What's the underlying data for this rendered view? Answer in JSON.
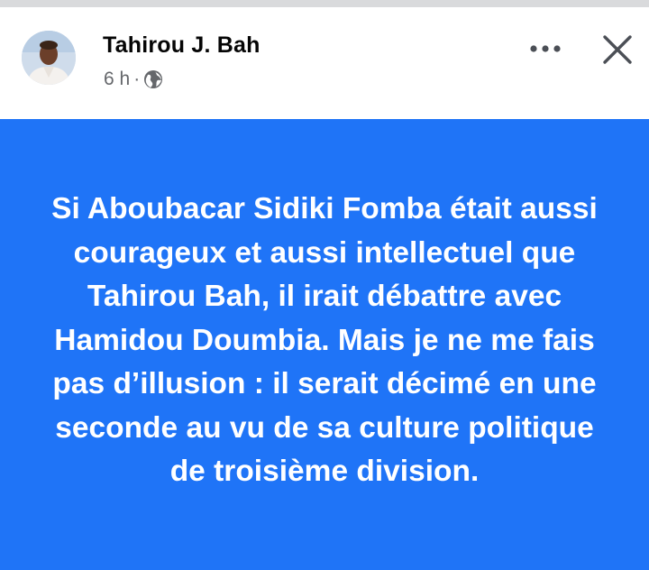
{
  "post": {
    "author_name": "Tahirou J. Bah",
    "timestamp": "6 h",
    "separator": "·",
    "privacy_icon": "globe-icon",
    "more_icon": "more-options-icon",
    "close_icon": "close-icon",
    "body_text": "Si Aboubacar Sidiki Fomba était aussi courageux et aussi intellectuel que Tahirou Bah, il irait débattre avec Hamidou Doumbia. Mais je ne me fais pas d’illusion : il serait décimé en une seconde au vu de sa culture politique de troisième division.",
    "background_color": "#1f74f7",
    "text_color": "#ffffff"
  }
}
